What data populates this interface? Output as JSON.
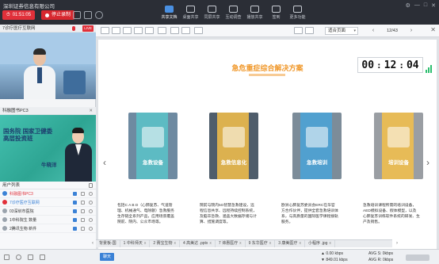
{
  "app": {
    "company": "深圳证券信息有限公司"
  },
  "session": {
    "elapsed": "01:51:05",
    "record_label": "停止录制"
  },
  "toolbar": [
    {
      "label": "共享文档",
      "active": true
    },
    {
      "label": "桌面共享",
      "active": false
    },
    {
      "label": "同屏共享",
      "active": false
    },
    {
      "label": "互动调查",
      "active": false
    },
    {
      "label": "播放共享",
      "active": false
    },
    {
      "label": "签到",
      "active": false
    },
    {
      "label": "更多功能",
      "active": false
    }
  ],
  "videos": [
    {
      "title": "7诊疗医疗互联网",
      "live_badge": "LIVE"
    },
    {
      "title": "科融图书PC3"
    }
  ],
  "presenter_card": {
    "title_line1": "国务院 国家卫健委",
    "title_line2": "高层投资班",
    "name": "牛晓洋"
  },
  "users": {
    "header": "用户列表",
    "rows": [
      {
        "name": "科融图书PC3",
        "avatar_color": "#3b82d6",
        "style": "host"
      },
      {
        "name": "7诊疗医疗互联网",
        "avatar_color": "#e1303a",
        "style": "live"
      },
      {
        "name": "03深圳市医院",
        "avatar_color": "#9aa3ad",
        "style": "normal"
      },
      {
        "name": "1中科院生 数量",
        "avatar_color": "#9aa3ad",
        "style": "normal"
      },
      {
        "name": "2腾讯生物 新件",
        "avatar_color": "#9aa3ad",
        "style": "normal"
      }
    ]
  },
  "document": {
    "fit_mode": "适合页面",
    "page_indicator": "12/43",
    "slide_title": "急危重症综合解决方案",
    "timer": {
      "hh": "00",
      "mm": "12",
      "ss": "04"
    },
    "cards": [
      {
        "label": "急救设备",
        "band_color": "#5bc3c9",
        "bg": "#6e8aa1"
      },
      {
        "label": "急救信息化",
        "band_color": "#f5c04a",
        "bg": "#4f5d6b"
      },
      {
        "label": "急救培训",
        "band_color": "#4aa3d8",
        "bg": "#7c8c99"
      },
      {
        "label": "培训设备",
        "band_color": "#f5c04a",
        "bg": "#9a9ea3"
      }
    ],
    "descriptions": [
      "包括C A B D（心肺复苏、气道管理、机械通气、电除颤）急救服务生存链全系列产品，应用场景覆盖院前、院内、公众市场等。",
      "院前与院内5G智慧急救建设，远程信息共享、远程持续控制系统，及脑卒急救、涵盖大数据存储与计算、措施调度等。",
      "欧洲心肺复苏委员会ERC在华官方合作伙伴，提供全套急救培训体系，与高质量的国际医学课程接轨服务。",
      "急救培训课程所需的培训设备，AED模拟设备、假体模型，以及心肺复苏训练软件系统的研发、生产及销售。"
    ]
  },
  "tabs": [
    {
      "label": "背景板-国",
      "ext": ""
    },
    {
      "label": "1 中科师天",
      "ext": "x"
    },
    {
      "label": "2 赛宝生物",
      "ext": "x"
    },
    {
      "label": "4 高美达 .pptx",
      "ext": "x"
    },
    {
      "label": "7 谛惠医疗",
      "ext": "x"
    },
    {
      "label": "9 东华医疗",
      "ext": "x"
    },
    {
      "label": "3 康美医疗",
      "ext": "x"
    },
    {
      "label": "小程序 .jpg",
      "ext": "x"
    }
  ],
  "status": {
    "button": "聊天",
    "upload": "0.00 kbps",
    "download": "849.01 kbps",
    "avg_s": "AVG S: 0kbps",
    "avg_r": "AVG R: 0kbps"
  }
}
